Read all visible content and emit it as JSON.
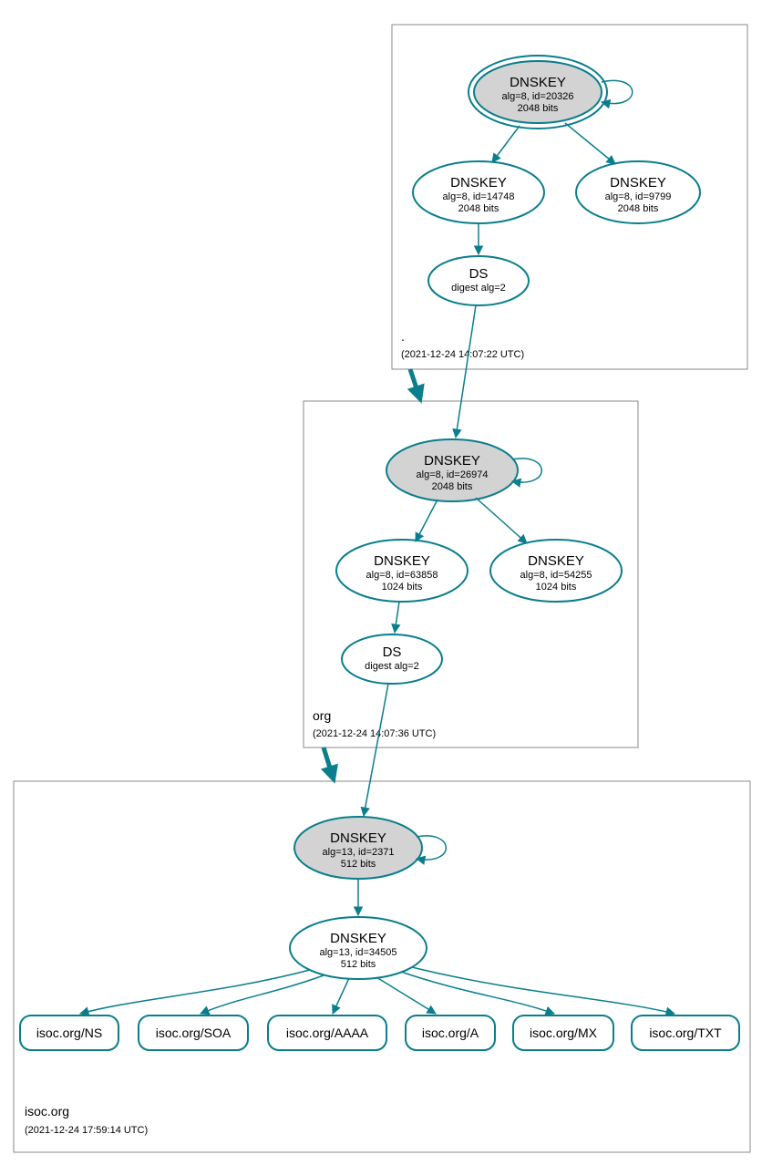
{
  "zones": {
    "root": {
      "label": ".",
      "timestamp": "(2021-12-24 14:07:22 UTC)"
    },
    "org": {
      "label": "org",
      "timestamp": "(2021-12-24 14:07:36 UTC)"
    },
    "isoc": {
      "label": "isoc.org",
      "timestamp": "(2021-12-24 17:59:14 UTC)"
    }
  },
  "nodes": {
    "root_ksk": {
      "title": "DNSKEY",
      "line1": "alg=8, id=20326",
      "line2": "2048 bits"
    },
    "root_zsk1": {
      "title": "DNSKEY",
      "line1": "alg=8, id=14748",
      "line2": "2048 bits"
    },
    "root_zsk2": {
      "title": "DNSKEY",
      "line1": "alg=8, id=9799",
      "line2": "2048 bits"
    },
    "root_ds": {
      "title": "DS",
      "line1": "digest alg=2"
    },
    "org_ksk": {
      "title": "DNSKEY",
      "line1": "alg=8, id=26974",
      "line2": "2048 bits"
    },
    "org_zsk1": {
      "title": "DNSKEY",
      "line1": "alg=8, id=63858",
      "line2": "1024 bits"
    },
    "org_zsk2": {
      "title": "DNSKEY",
      "line1": "alg=8, id=54255",
      "line2": "1024 bits"
    },
    "org_ds": {
      "title": "DS",
      "line1": "digest alg=2"
    },
    "isoc_ksk": {
      "title": "DNSKEY",
      "line1": "alg=13, id=2371",
      "line2": "512 bits"
    },
    "isoc_zsk": {
      "title": "DNSKEY",
      "line1": "alg=13, id=34505",
      "line2": "512 bits"
    }
  },
  "records": {
    "ns": "isoc.org/NS",
    "soa": "isoc.org/SOA",
    "aaaa": "isoc.org/AAAA",
    "a": "isoc.org/A",
    "mx": "isoc.org/MX",
    "txt": "isoc.org/TXT"
  }
}
